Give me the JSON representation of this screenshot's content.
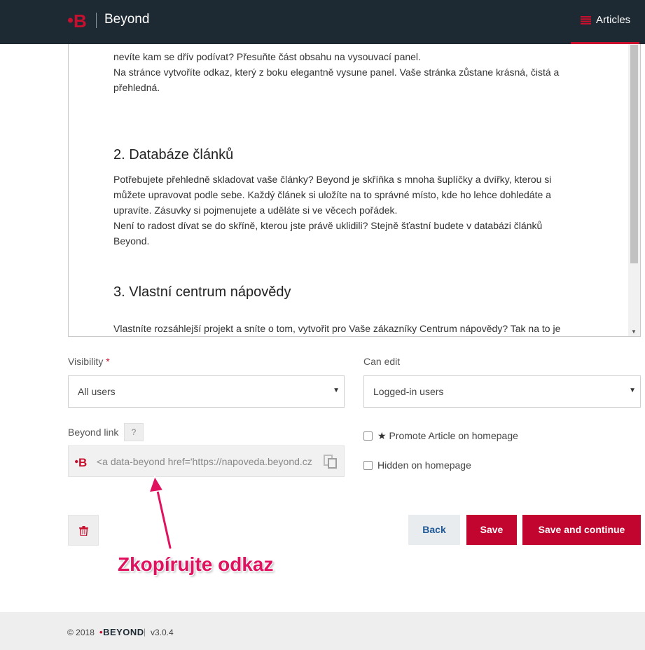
{
  "header": {
    "brand": "Beyond",
    "nav_articles": "Articles"
  },
  "editor": {
    "p_top_line1": "nevíte kam se dřív podívat? Přesuňte část obsahu na vysouvací panel.",
    "p_top_line2": "Na stránce vytvoříte odkaz, který z boku elegantně vysune panel. Vaše stránka zůstane krásná, čistá a",
    "p_top_line3": "přehledná.",
    "h2_database": "2. Databáze článků",
    "p_db_line1": "Potřebujete přehledně skladovat vaše články? Beyond je skříňka s mnoha šuplíčky a dvířky, kterou si",
    "p_db_line2": "můžete upravovat podle sebe. Každý článek si uložíte na to správné místo, kde ho lehce dohledáte a",
    "p_db_line3": "upravíte. Zásuvky si pojmenujete a uděláte si ve věcech pořádek.",
    "p_db_line4": "Není to radost dívat se do skříně, kterou jste právě uklidili? Stejně šťastní budete v databázi článků",
    "p_db_line5": "Beyond.",
    "h2_help": "3. Vlastní centrum nápovědy",
    "p_help_line1": "Vlastníte rozsáhlejší projekt a sníte o tom, vytvořit pro Vaše zákazníky Centrum nápovědy? Tak na to je"
  },
  "form": {
    "visibility_label": "Visibility",
    "visibility_required": "*",
    "visibility_value": "All users",
    "can_edit_label": "Can edit",
    "can_edit_value": "Logged-in users",
    "beyond_link_label": "Beyond link",
    "help_glyph": "?",
    "beyond_link_value": "<a data-beyond href='https://napoveda.beyond.cz",
    "promote_label": "Promote Article on homepage",
    "promote_checked": false,
    "hidden_label": "Hidden on homepage",
    "hidden_checked": false
  },
  "actions": {
    "back": "Back",
    "save": "Save",
    "save_continue": "Save and continue"
  },
  "annotation": {
    "text": "Zkopírujte odkaz"
  },
  "footer": {
    "copyright": "© 2018",
    "brand_dot": "•",
    "brand": "BEYOND",
    "separator": "|",
    "version": "v3.0.4"
  },
  "colors": {
    "header_bg": "#1e2a33",
    "brand_red": "#c8102e",
    "button_red": "#c1052f",
    "annotation_pink": "#e0115f"
  },
  "icons": {
    "logo": "beyond-b-logo-icon",
    "nav": "list-icon",
    "copy": "copy-icon",
    "delete": "trash-icon",
    "star": "star-icon"
  }
}
